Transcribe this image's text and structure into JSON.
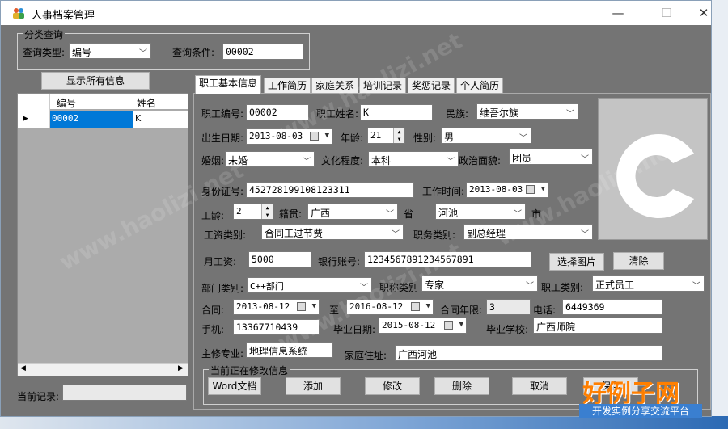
{
  "window": {
    "title": "人事档案管理",
    "minimize": "—",
    "maximize": "☐",
    "close": "✕"
  },
  "search": {
    "group_title": "分类查询",
    "type_label": "查询类型:",
    "type_value": "编号",
    "cond_label": "查询条件:",
    "cond_value": "00002",
    "show_all": "显示所有信息"
  },
  "grid": {
    "columns": [
      "编号",
      "姓名"
    ],
    "rows": [
      {
        "id": "00002",
        "name": "K"
      }
    ]
  },
  "current_record_label": "当前记录:",
  "tabs": [
    "职工基本信息",
    "工作简历",
    "家庭关系",
    "培训记录",
    "奖惩记录",
    "个人简历"
  ],
  "form": {
    "emp_no_label": "职工编号:",
    "emp_no": "00002",
    "emp_name_label": "职工姓名:",
    "emp_name": "K",
    "ethnic_label": "民族:",
    "ethnic": "维吾尔族",
    "birth_label": "出生日期:",
    "birth": "2013-08-03",
    "age_label": "年龄:",
    "age": "21",
    "sex_label": "性别:",
    "sex": "男",
    "marriage_label": "婚姻:",
    "marriage": "未婚",
    "edu_label": "文化程度:",
    "edu": "本科",
    "politics_label": "政治面貌:",
    "politics": "团员",
    "id_label": "身份证号:",
    "id_no": "452728199108123311",
    "work_time_label": "工作时间:",
    "work_time": "2013-08-03",
    "seniority_label": "工龄:",
    "seniority": "2",
    "native_label": "籍贯:",
    "province": "广西",
    "province_suffix": "省",
    "city": "河池",
    "city_suffix": "市",
    "salary_type_label": "工资类别:",
    "salary_type": "合同工过节费",
    "duty_label": "职务类别:",
    "duty": "副总经理",
    "monthly_label": "月工资:",
    "monthly": "5000",
    "bank_label": "银行账号:",
    "bank": "1234567891234567891",
    "pick_photo": "选择图片",
    "clear": "清除",
    "dept_label": "部门类别:",
    "dept": "C++部门",
    "title_label": "职称类别",
    "title_value": "专家",
    "emp_type_label": "职工类别:",
    "emp_type": "正式员工",
    "contract_label": "合同:",
    "contract_from": "2013-08-12",
    "to_label": "至",
    "contract_to": "2016-08-12",
    "contract_years_label": "合同年限:",
    "contract_years": "3",
    "phone_label": "电话:",
    "phone": "6449369",
    "mobile_label": "手机:",
    "mobile": "13367710439",
    "grad_date_label": "毕业日期:",
    "grad_date": "2015-08-12",
    "school_label": "毕业学校:",
    "school": "广西师院",
    "major_label": "主修专业:",
    "major": "地理信息系统",
    "address_label": "家庭住址:",
    "address": "广西河池"
  },
  "edit_group": {
    "title": "当前正在修改信息",
    "buttons": [
      "Word文档",
      "添加",
      "修改",
      "删除",
      "取消",
      "保存"
    ]
  },
  "watermark": {
    "site": "www.haolizi.net",
    "brand": "好例子网",
    "slogan": "开发实例分享交流平台"
  },
  "colors": {
    "window_bg": "#747474",
    "selection": "#0078d7",
    "brand_orange": "#ff7f00"
  }
}
